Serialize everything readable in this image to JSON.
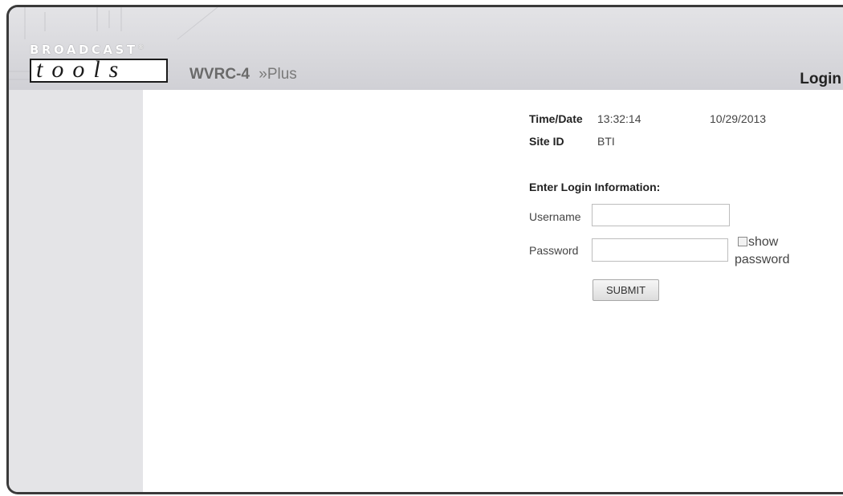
{
  "brand": {
    "logo_top": "BROADCAST",
    "logo_mark": "®",
    "logo_bottom": "tools",
    "product_name": "WVRC-4",
    "product_separator": "»",
    "product_sub": "Plus"
  },
  "page": {
    "title": "Login"
  },
  "status": {
    "time_date_label": "Time/Date",
    "time": "13:32:14",
    "date": "10/29/2013",
    "site_id_label": "Site ID",
    "site_id": "BTI"
  },
  "login_form": {
    "heading": "Enter Login Information:",
    "username_label": "Username",
    "username_value": "",
    "password_label": "Password",
    "password_value": "",
    "show_password_label": "show password",
    "show_password_checked": false,
    "submit_label": "SUBMIT"
  },
  "colors": {
    "header_bg": "#dcdce0",
    "sidebar_bg": "#e4e4e7",
    "frame_border": "#3a3a3a"
  }
}
